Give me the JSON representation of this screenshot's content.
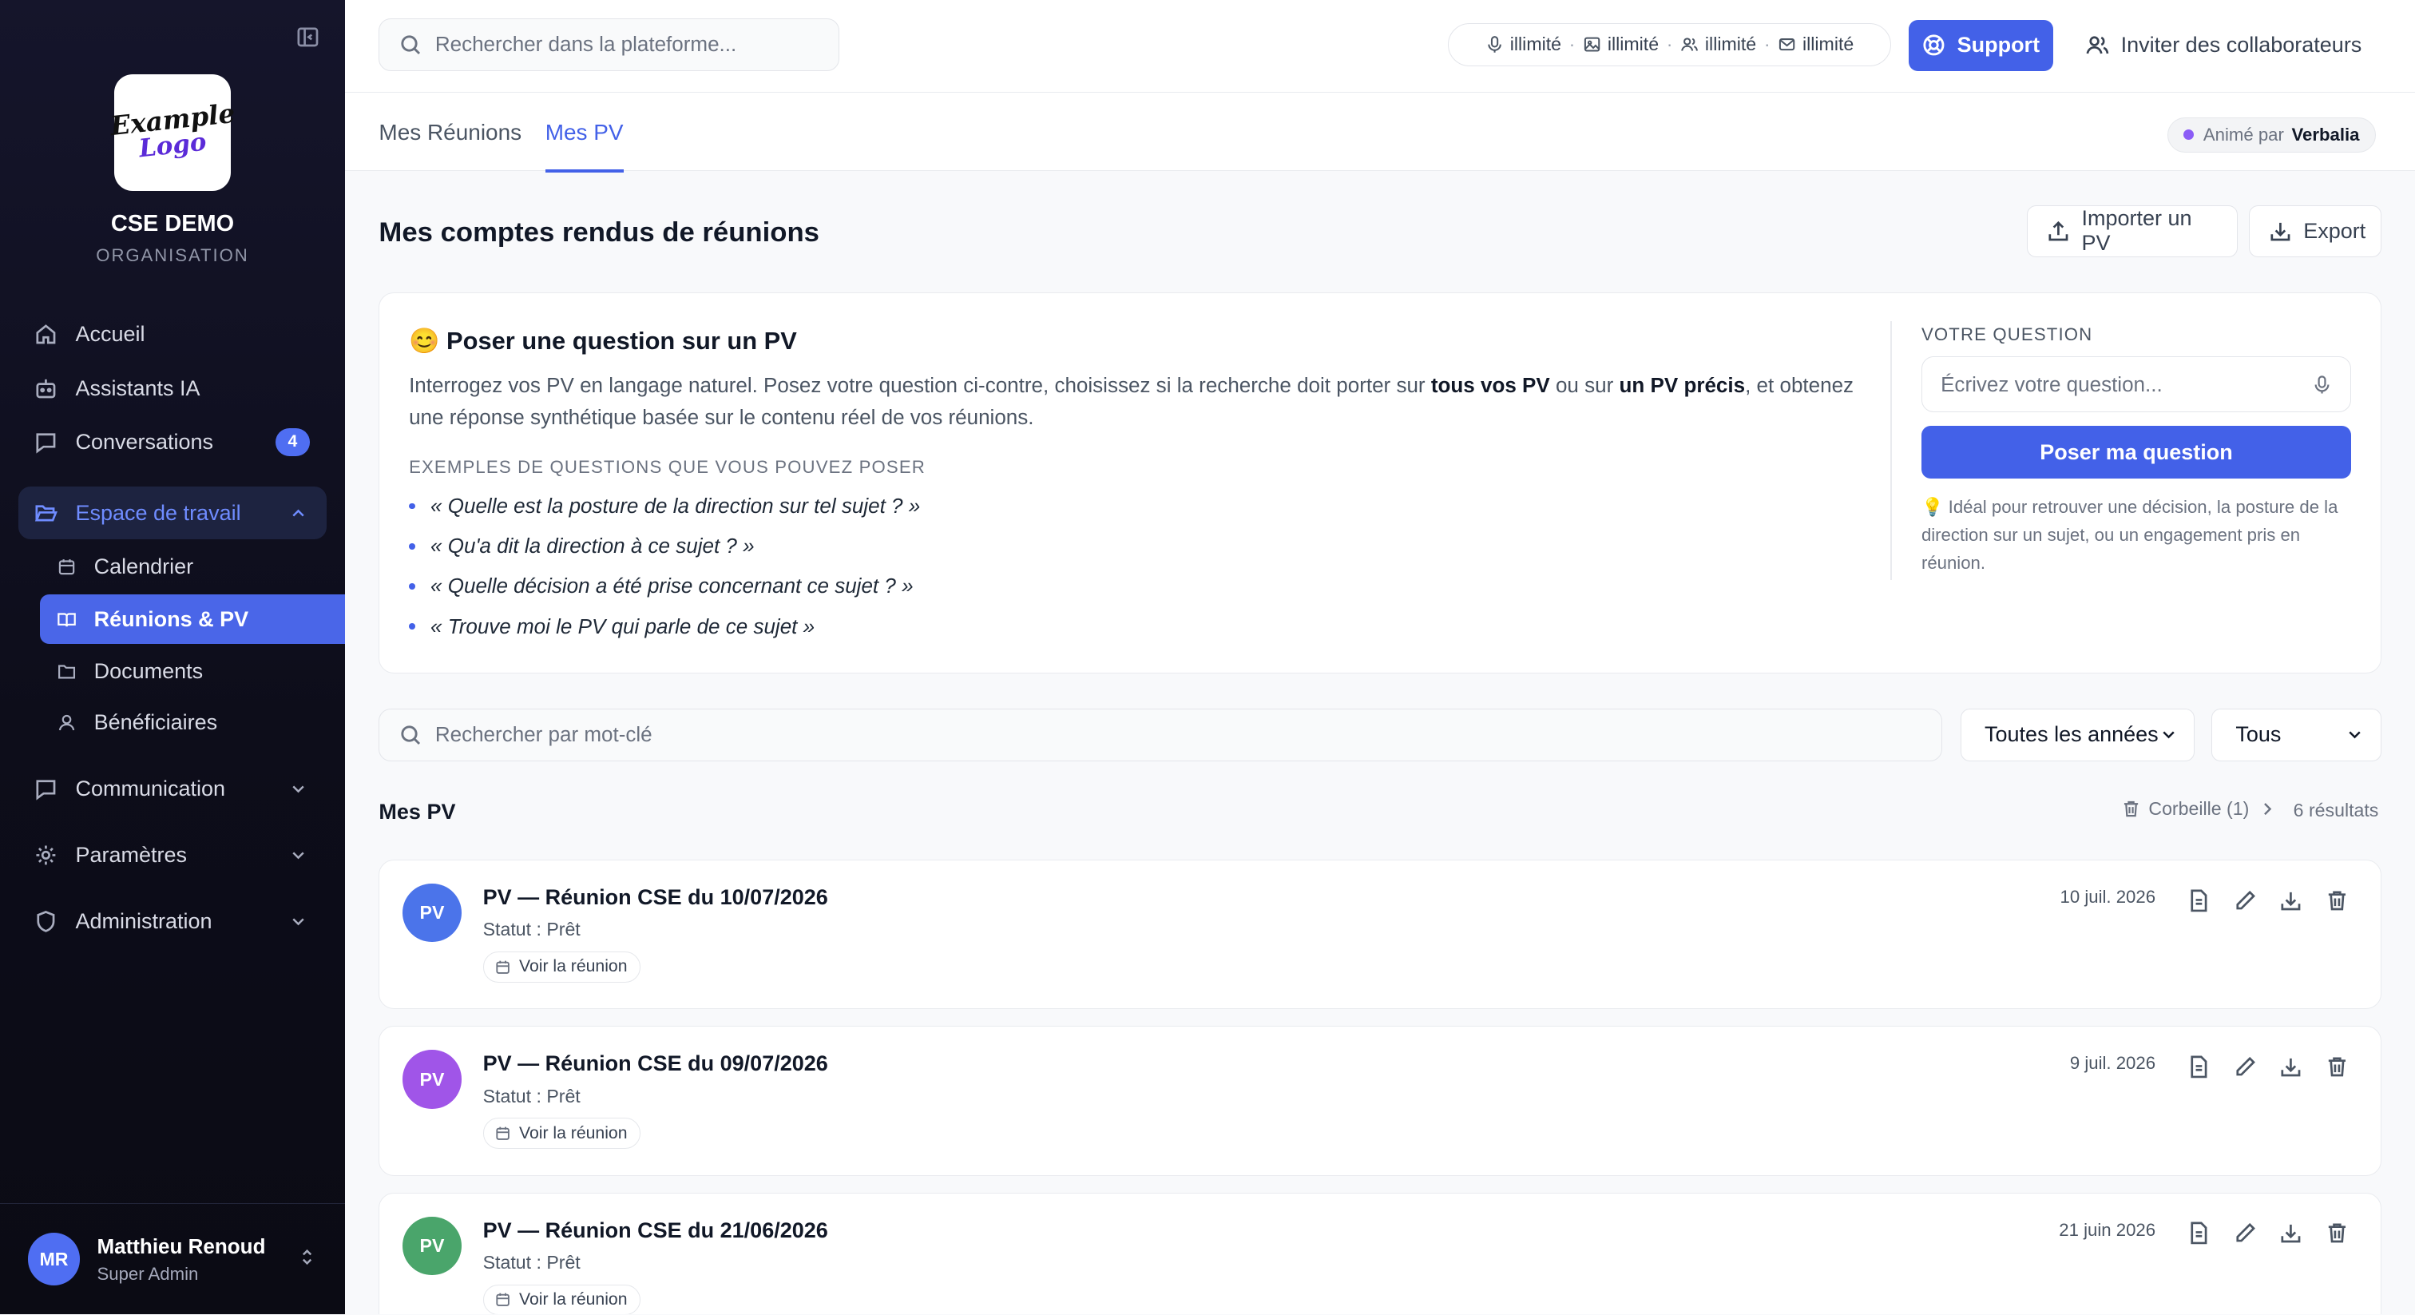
{
  "sidebar": {
    "logo_line1": "Example",
    "logo_line2": "Logo",
    "org_name": "CSE DEMO",
    "org_type": "ORGANISATION",
    "nav": {
      "home": "Accueil",
      "assistants": "Assistants IA",
      "conversations": "Conversations",
      "conversations_badge": "4",
      "workspace": "Espace de travail",
      "communication": "Communication",
      "settings": "Paramètres",
      "admin": "Administration"
    },
    "workspace_items": {
      "calendar": "Calendrier",
      "meetings": "Réunions & PV",
      "documents": "Documents",
      "beneficiaries": "Bénéficiaires"
    },
    "user": {
      "initials": "MR",
      "name": "Matthieu Renoud",
      "role": "Super Admin"
    }
  },
  "topbar": {
    "search_placeholder": "Rechercher dans la plateforme...",
    "quota": {
      "audio": "illimité",
      "images": "illimité",
      "users": "illimité",
      "emails": "illimité"
    },
    "support_label": "Support",
    "invite_label": "Inviter des collaborateurs"
  },
  "tabs": {
    "meetings": "Mes Réunions",
    "pv": "Mes PV",
    "animated_prefix": "Animé par",
    "animated_by": "Verbalia"
  },
  "page": {
    "title": "Mes comptes rendus de réunions",
    "import_label": "Importer un PV",
    "export_label": "Export"
  },
  "ask": {
    "emoji": "😊",
    "title": "Poser une question sur un PV",
    "desc_1": "Interrogez vos PV en langage naturel. Posez votre question ci-contre, choisissez si la recherche doit porter sur ",
    "desc_b1": "tous vos PV",
    "desc_2": " ou sur ",
    "desc_b2": "un PV précis",
    "desc_3": ", et obtenez une réponse synthétique basée sur le contenu réel de vos réunions.",
    "examples_title": "EXEMPLES DE QUESTIONS QUE VOUS POUVEZ POSER",
    "examples": [
      "« Quelle est la posture de la direction sur tel sujet ? »",
      "« Qu'a dit la direction à ce sujet ? »",
      "« Quelle décision a été prise concernant ce sujet ? »",
      "« Trouve moi le PV qui parle de ce sujet »"
    ],
    "question_label": "VOTRE QUESTION",
    "question_placeholder": "Écrivez votre question...",
    "button": "Poser ma question",
    "tip_icon": "💡",
    "tip": " Idéal pour retrouver une décision, la posture de la direction sur un sujet, ou un engagement pris en réunion."
  },
  "filters": {
    "keyword_placeholder": "Rechercher par mot-clé",
    "year_value": "Toutes les années",
    "status_value": "Tous"
  },
  "list": {
    "title": "Mes PV",
    "trash_label": "Corbeille (1)",
    "results": "6 résultats",
    "items": [
      {
        "avatar": "PV",
        "color": "#4b74ea",
        "title": "PV — Réunion CSE du 10/07/2026",
        "status": "Statut : Prêt",
        "link": "Voir la réunion",
        "date": "10 juil. 2026"
      },
      {
        "avatar": "PV",
        "color": "#a055e8",
        "title": "PV — Réunion CSE du 09/07/2026",
        "status": "Statut : Prêt",
        "link": "Voir la réunion",
        "date": "9 juil. 2026"
      },
      {
        "avatar": "PV",
        "color": "#4aa56b",
        "title": "PV — Réunion CSE du 21/06/2026",
        "status": "Statut : Prêt",
        "link": "Voir la réunion",
        "date": "21 juin 2026"
      }
    ]
  },
  "colors": {
    "accent": "#4361e8",
    "sidebar_bg": "#0d0d1a"
  }
}
